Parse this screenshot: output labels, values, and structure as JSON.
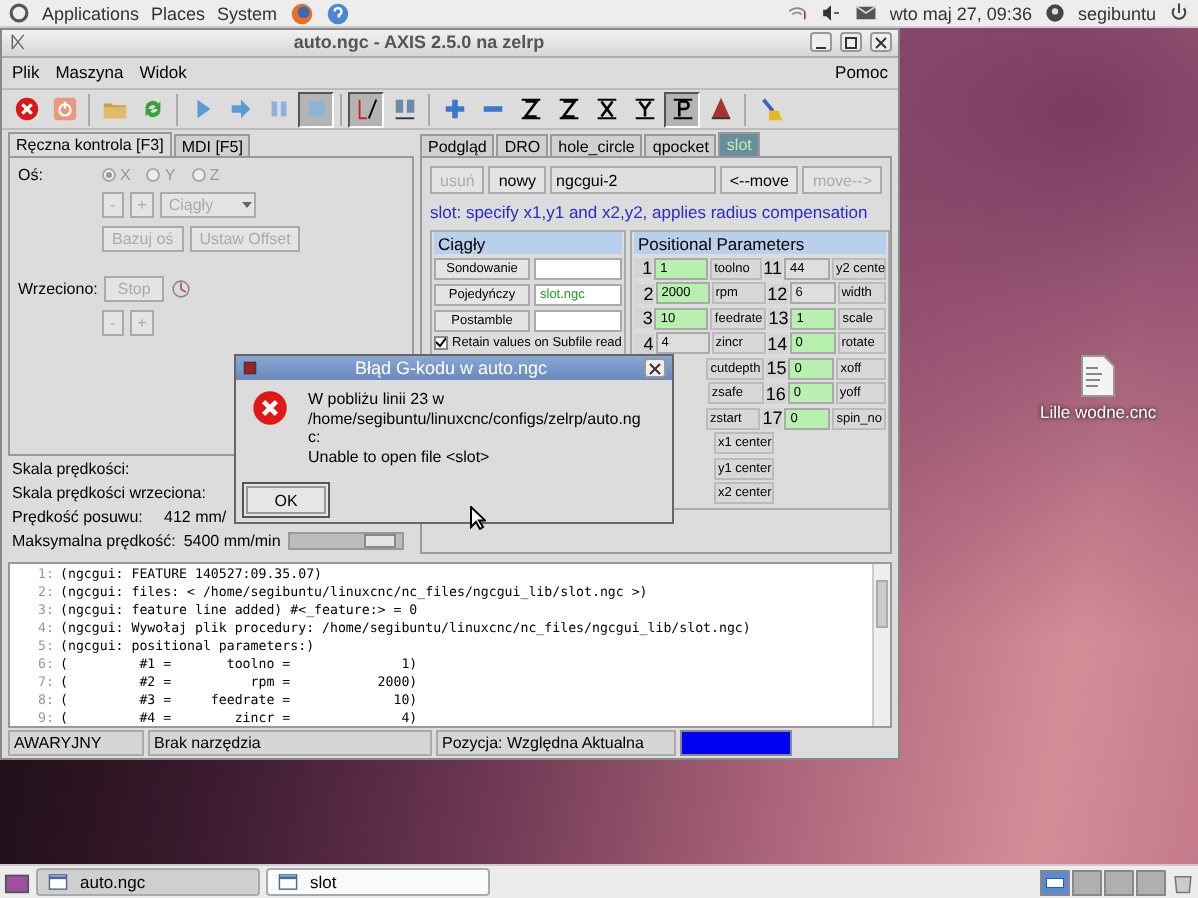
{
  "top_panel": {
    "menus": [
      "Applications",
      "Places",
      "System"
    ],
    "clock": "wto maj 27, 09:36",
    "user": "segibuntu"
  },
  "window": {
    "title": "auto.ngc - AXIS 2.5.0 na zelrp",
    "menus": [
      "Plik",
      "Maszyna",
      "Widok"
    ],
    "help_menu": "Pomoc"
  },
  "toolbar": [
    {
      "kind": "estop",
      "pressed": false
    },
    {
      "kind": "power",
      "pressed": false
    },
    {
      "kind": "sep"
    },
    {
      "kind": "open",
      "pressed": false
    },
    {
      "kind": "reload",
      "pressed": false
    },
    {
      "kind": "sep"
    },
    {
      "kind": "run",
      "pressed": false
    },
    {
      "kind": "step",
      "pressed": false
    },
    {
      "kind": "pause",
      "pressed": false
    },
    {
      "kind": "stop",
      "pressed": true
    },
    {
      "kind": "sep"
    },
    {
      "kind": "touch",
      "pressed": true
    },
    {
      "kind": "ml",
      "pressed": false
    },
    {
      "kind": "sep"
    },
    {
      "kind": "zoomin",
      "pressed": false
    },
    {
      "kind": "zoomout",
      "pressed": false
    },
    {
      "kind": "viewz",
      "pressed": false
    },
    {
      "kind": "viewz2",
      "pressed": false
    },
    {
      "kind": "viewx",
      "pressed": false
    },
    {
      "kind": "viewy",
      "pressed": false
    },
    {
      "kind": "viewp",
      "pressed": true
    },
    {
      "kind": "cone",
      "pressed": false
    },
    {
      "kind": "sep"
    },
    {
      "kind": "brush",
      "pressed": false
    }
  ],
  "left_tabs": [
    {
      "label": "Ręczna kontrola [F3]",
      "selected": true
    },
    {
      "label": "MDI [F5]",
      "selected": false
    }
  ],
  "manual": {
    "axis_label": "Oś:",
    "axes": [
      {
        "label": "X",
        "selected": true
      },
      {
        "label": "Y",
        "selected": false
      },
      {
        "label": "Z",
        "selected": false
      }
    ],
    "jog_minus": "-",
    "jog_plus": "+",
    "increment": "Ciągły",
    "home_button": "Bazuj oś",
    "offset_button": "Ustaw Offset",
    "spindle_label": "Wrzeciono:",
    "spindle_stop": "Stop",
    "spindle_minus": "-",
    "spindle_plus": "+",
    "disabled": true
  },
  "speeds": [
    {
      "label": "Skala prędkości:"
    },
    {
      "label": "Skala prędkości wrzeciona:"
    },
    {
      "label": "Prędkość posuwu:",
      "value": "412 mm/"
    },
    {
      "label": "Maksymalna prędkość:",
      "value": "5400 mm/min",
      "level": 0.88
    }
  ],
  "right_tabs": [
    {
      "label": "Podgląd",
      "selected": false
    },
    {
      "label": "DRO",
      "selected": false
    },
    {
      "label": "hole_circle",
      "selected": false
    },
    {
      "label": "qpocket",
      "selected": false
    },
    {
      "label": "slot",
      "selected": true
    }
  ],
  "ngcgui": {
    "delete_button": {
      "label": "usuń",
      "disabled": true
    },
    "new_button": {
      "label": "nowy",
      "disabled": false
    },
    "name": "ngcgui-2",
    "move_left": {
      "label": "<--move",
      "disabled": false
    },
    "move_right": {
      "label": "move-->",
      "disabled": true
    },
    "info": "slot: specify x1,y1 and x2,y2, applies radius compensation",
    "options_title": "Ciągły",
    "options": [
      {
        "label": "Sondowanie"
      },
      {
        "label": "Pojedyńczy",
        "value": "slot.ngc"
      },
      {
        "label": "Postamble"
      }
    ],
    "retain": {
      "label": "Retain values on Subfile read",
      "checked": true
    },
    "params_title": "Positional Parameters",
    "params": [
      {
        "left": {
          "number": "1",
          "value": "1",
          "label": "toolno",
          "modified": true
        },
        "right": {
          "number": "11",
          "value": "44",
          "label": "y2 cente",
          "modified": false
        }
      },
      {
        "left": {
          "number": "2",
          "value": "2000",
          "label": "rpm",
          "modified": true
        },
        "right": {
          "number": "12",
          "value": "6",
          "label": "width",
          "modified": false
        }
      },
      {
        "left": {
          "number": "3",
          "value": "10",
          "label": "feedrate",
          "modified": true
        },
        "right": {
          "number": "13",
          "value": "1",
          "label": "scale",
          "modified": true
        }
      },
      {
        "left": {
          "number": "4",
          "value": "4",
          "label": "zincr",
          "modified": false
        },
        "right": {
          "number": "14",
          "value": "0",
          "label": "rotate",
          "modified": true
        }
      },
      {
        "left": {
          "label": "cutdepth"
        },
        "right": {
          "number": "15",
          "value": "0",
          "label": "xoff",
          "modified": true
        }
      },
      {
        "left": {
          "label": "zsafe"
        },
        "right": {
          "number": "16",
          "value": "0",
          "label": "yoff",
          "modified": true
        }
      },
      {
        "left": {
          "label": "zstart"
        },
        "right": {
          "number": "17",
          "value": "0",
          "label": "spin_no",
          "modified": true
        }
      },
      {
        "left": {
          "label": "x1 center"
        }
      },
      {
        "left": {
          "label": "y1 center"
        }
      },
      {
        "left": {
          "label": "x2 center"
        }
      }
    ]
  },
  "gcode_lines": [
    {
      "number": "1:",
      "text": "(ngcgui: FEATURE 140527:09.35.07)"
    },
    {
      "number": "2:",
      "text": "(ngcgui: files: < /home/segibuntu/linuxcnc/nc_files/ngcgui_lib/slot.ngc >)"
    },
    {
      "number": "3:",
      "text": "(ngcgui: feature line added) #<_feature:> = 0"
    },
    {
      "number": "4:",
      "text": "(ngcgui: Wywołaj plik procedury: /home/segibuntu/linuxcnc/nc_files/ngcgui_lib/slot.ngc)"
    },
    {
      "number": "5:",
      "text": "(ngcgui: positional parameters:)"
    },
    {
      "number": "6:",
      "text": "(         #1 =       toolno =              1)"
    },
    {
      "number": "7:",
      "text": "(         #2 =          rpm =           2000)"
    },
    {
      "number": "8:",
      "text": "(         #3 =     feedrate =             10)"
    },
    {
      "number": "9:",
      "text": "(         #4 =        zincr =              4)"
    }
  ],
  "status_bar": {
    "estop": "AWARYJNY",
    "tool": "Brak narzędzia",
    "position": "Pozycja: Względna Aktualna"
  },
  "dialog": {
    "title": "Błąd G-kodu w auto.ngc",
    "lines": [
      "W pobliżu linii 23 w",
      "/home/segibuntu/linuxcnc/configs/zelrp/auto.ng",
      "c:",
      "Unable to open file <slot>"
    ],
    "ok": "OK"
  },
  "desktop_icon": {
    "label": "Lille wodne.cnc"
  },
  "taskbar": {
    "tasks": [
      {
        "label": "auto.ngc",
        "selected": true
      },
      {
        "label": "slot",
        "selected": false
      }
    ],
    "workspaces": [
      {
        "selected": true
      },
      {
        "selected": false
      },
      {
        "selected": false
      },
      {
        "selected": false
      }
    ]
  }
}
